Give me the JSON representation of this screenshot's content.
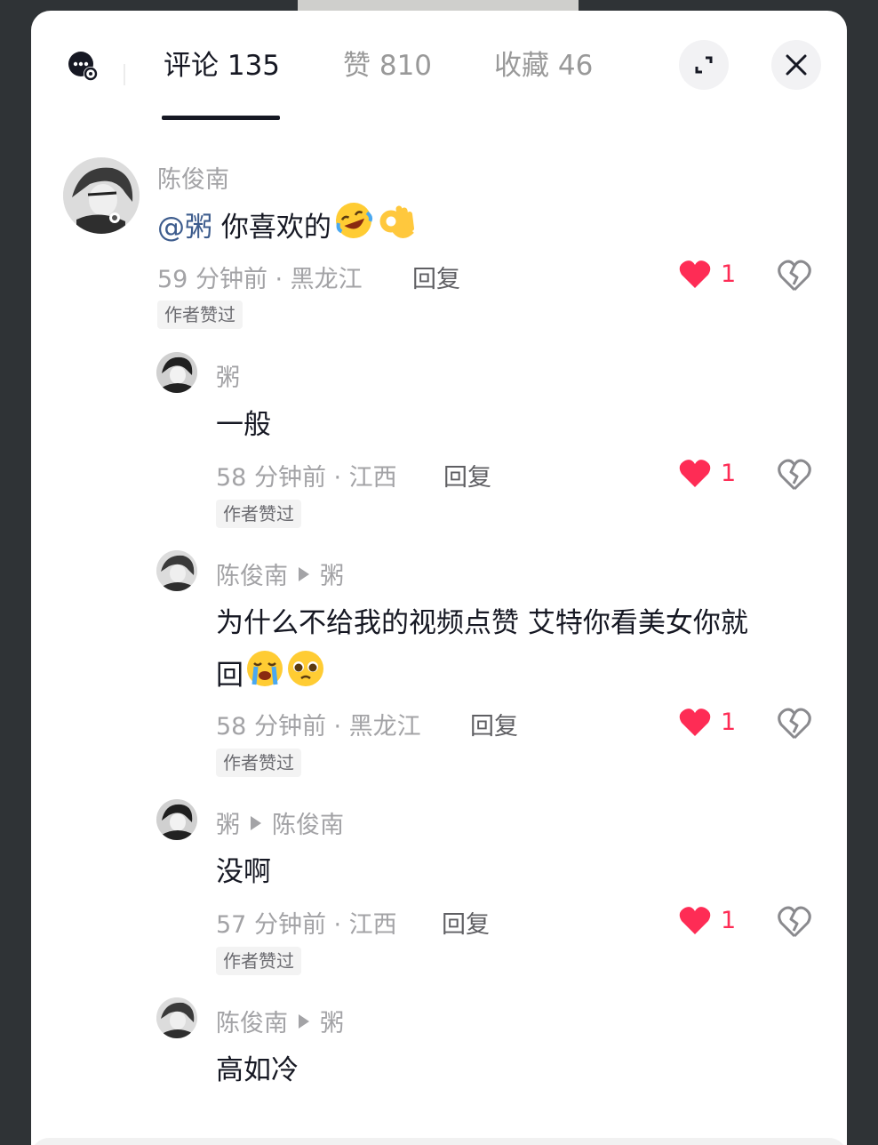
{
  "header": {
    "tabs": [
      {
        "label": "评论 135"
      },
      {
        "label": "赞 810"
      },
      {
        "label": "收藏 46"
      }
    ],
    "icons": [
      "comment-settings-icon",
      "expand-icon",
      "close-icon"
    ]
  },
  "comments": [
    {
      "author": "陈俊南",
      "mention": "@粥",
      "text": "你喜欢的",
      "emojis": [
        "rofl-emoji",
        "ok-hand-emoji"
      ],
      "meta": "59 分钟前 · 黑龙江",
      "reply_label": "回复",
      "badge": "作者赞过",
      "likes": "1"
    },
    {
      "author": "粥",
      "text": "一般",
      "meta": "58 分钟前 · 江西",
      "reply_label": "回复",
      "badge": "作者赞过",
      "likes": "1"
    },
    {
      "author": "陈俊南",
      "reply_to": "粥",
      "text_line1": "为什么不给我的视频点赞 艾特你看美女你就",
      "text_line2": "回",
      "emojis": [
        "crying-emoji",
        "pleading-emoji"
      ],
      "meta": "58 分钟前 · 黑龙江",
      "reply_label": "回复",
      "badge": "作者赞过",
      "likes": "1"
    },
    {
      "author": "粥",
      "reply_to": "陈俊南",
      "text": "没啊",
      "meta": "57 分钟前 · 江西",
      "reply_label": "回复",
      "badge": "作者赞过",
      "likes": "1"
    },
    {
      "author": "陈俊南",
      "reply_to": "粥",
      "text": "高如冷"
    }
  ],
  "colors": {
    "like": "#fe2c55",
    "mention": "#3d5c8d",
    "text": "#161823",
    "muted": "#a3a3a6"
  }
}
